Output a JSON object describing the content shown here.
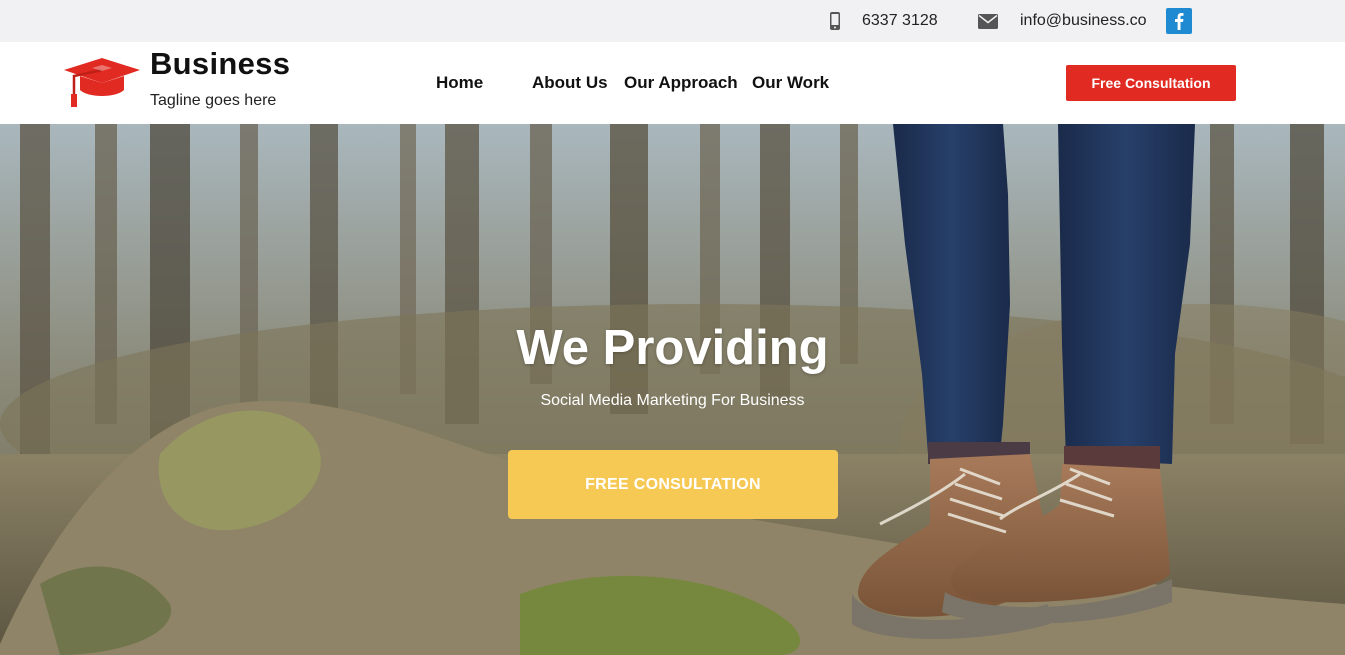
{
  "topbar": {
    "phone_icon": "mobile-phone-icon",
    "phone": "6337 3128",
    "mail_icon": "envelope-icon",
    "email": "info@business.co",
    "social_icon": "facebook-icon"
  },
  "header": {
    "logo_icon": "graduation-cap-icon",
    "brand_name": "Business",
    "tagline": "Tagline goes here",
    "nav": [
      "Home",
      "About Us",
      "Our Approach",
      "Our Work"
    ],
    "cta_label": "Free Consultation"
  },
  "hero": {
    "background": "forest-boots-photo",
    "title": "We Providing",
    "subtitle": "Social Media Marketing For Business",
    "cta_label": "FREE CONSULTATION"
  },
  "colors": {
    "topbar_bg": "#f1f1f3",
    "accent_red": "#e02a22",
    "accent_yellow": "#f6c955",
    "facebook_blue": "#1f8ad1"
  }
}
